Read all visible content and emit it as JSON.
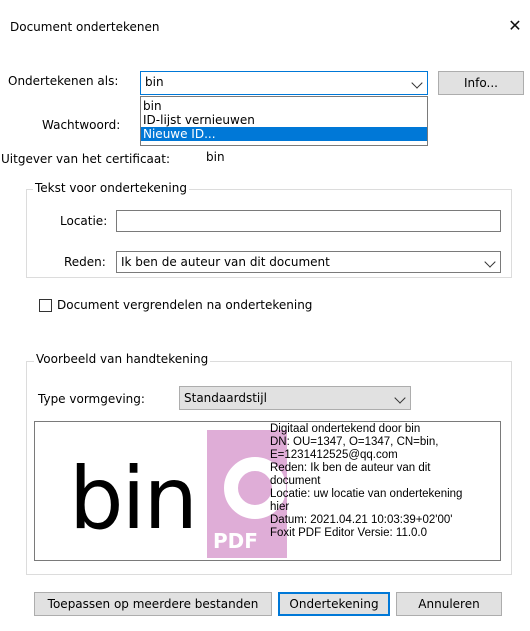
{
  "window": {
    "title": "Document ondertekenen",
    "close_glyph": "✕"
  },
  "sign_as": {
    "label": "Ondertekenen als:",
    "value": "bin",
    "info_button": "Info..."
  },
  "dropdown": {
    "items": [
      "bin",
      "ID-lijst vernieuwen",
      "Nieuwe ID..."
    ],
    "selected_index": 2
  },
  "password": {
    "label": "Wachtwoord:"
  },
  "issuer": {
    "label": "Uitgever van het certificaat:",
    "value": "bin"
  },
  "sig_text_group": {
    "title": "Tekst voor ondertekening",
    "location_label": "Locatie:",
    "location_value": "",
    "reason_label": "Reden:",
    "reason_value": "Ik ben de auteur van dit document"
  },
  "lock_checkbox": {
    "label": "Document vergrendelen na ondertekening",
    "checked": false
  },
  "preview_group": {
    "title": "Voorbeeld van handtekening",
    "type_label": "Type vormgeving:",
    "type_value": "Standaardstijl",
    "signature_name": "bin",
    "watermark_text": "PDF",
    "signature_lines": [
      "Digitaal ondertekend door bin",
      "DN: OU=1347, O=1347, CN=bin,",
      "E=1231412525@qq.com",
      "Reden: Ik ben de auteur van dit",
      "document",
      "Locatie: uw locatie van ondertekening",
      "hier",
      "Datum: 2021.04.21 10:03:39+02'00'",
      "Foxit PDF Editor Versie: 11.0.0"
    ]
  },
  "buttons": {
    "apply_multiple": "Toepassen op meerdere bestanden",
    "sign": "Ondertekening",
    "cancel": "Annuleren"
  },
  "colors": {
    "accent": "#0078d7",
    "watermark": "#c56bb8",
    "button_bg": "#e1e1e1"
  }
}
